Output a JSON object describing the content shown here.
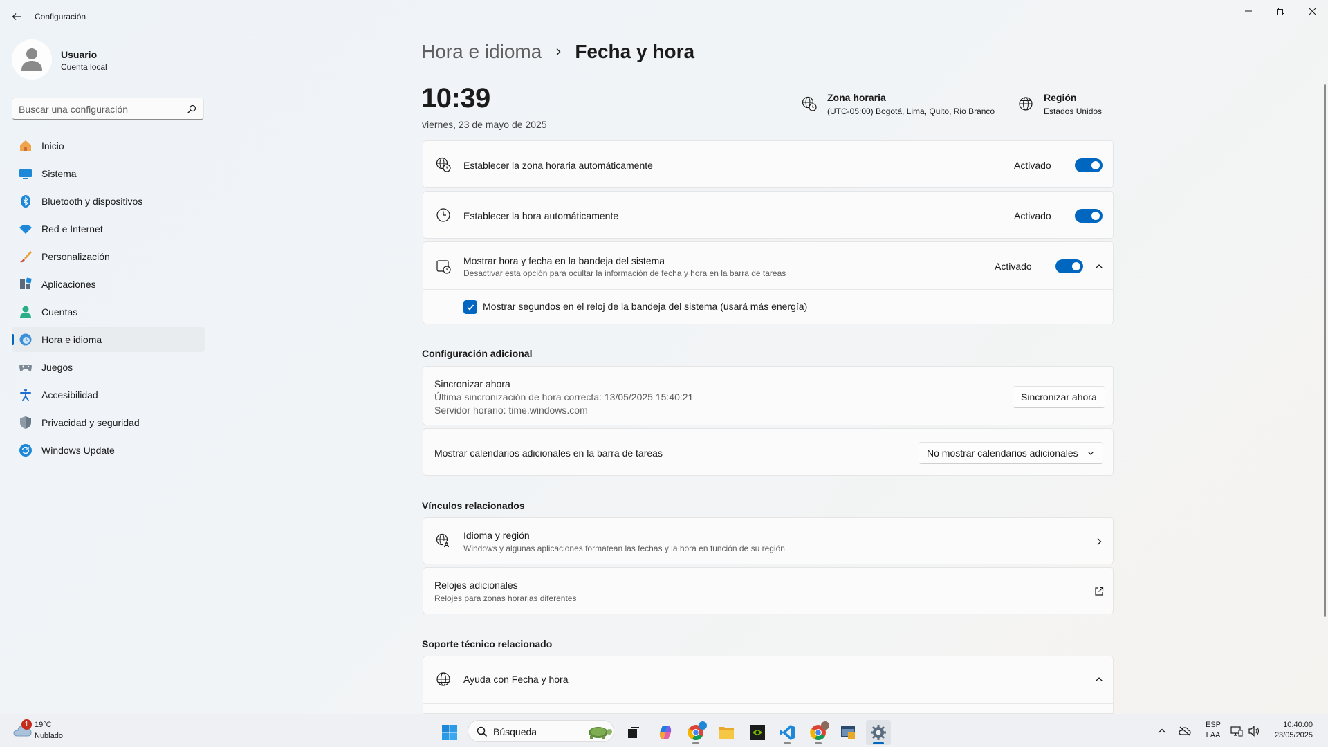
{
  "window": {
    "title": "Configuración"
  },
  "profile": {
    "name": "Usuario",
    "account": "Cuenta local"
  },
  "search": {
    "placeholder": "Buscar una configuración"
  },
  "sidebar": {
    "items": [
      {
        "label": "Inicio",
        "icon": "home-icon"
      },
      {
        "label": "Sistema",
        "icon": "system-icon"
      },
      {
        "label": "Bluetooth y dispositivos",
        "icon": "bluetooth-icon"
      },
      {
        "label": "Red e Internet",
        "icon": "wifi-icon"
      },
      {
        "label": "Personalización",
        "icon": "brush-icon"
      },
      {
        "label": "Aplicaciones",
        "icon": "apps-icon"
      },
      {
        "label": "Cuentas",
        "icon": "accounts-icon"
      },
      {
        "label": "Hora e idioma",
        "icon": "time-language-icon",
        "active": true
      },
      {
        "label": "Juegos",
        "icon": "gamepad-icon"
      },
      {
        "label": "Accesibilidad",
        "icon": "accessibility-icon"
      },
      {
        "label": "Privacidad y seguridad",
        "icon": "shield-icon"
      },
      {
        "label": "Windows Update",
        "icon": "update-icon"
      }
    ]
  },
  "breadcrumb": {
    "parent": "Hora e idioma",
    "current": "Fecha y hora"
  },
  "clock": {
    "time": "10:39",
    "date": "viernes, 23 de mayo de 2025"
  },
  "timezone": {
    "title": "Zona horaria",
    "value": "(UTC-05:00) Bogotá, Lima, Quito, Rio Branco"
  },
  "region": {
    "title": "Región",
    "value": "Estados Unidos"
  },
  "settings": {
    "auto_timezone": {
      "label": "Establecer la zona horaria automáticamente",
      "state": "Activado"
    },
    "auto_time": {
      "label": "Establecer la hora automáticamente",
      "state": "Activado"
    },
    "show_tray": {
      "label": "Mostrar hora y fecha en la bandeja del sistema",
      "description": "Desactivar esta opción para ocultar la información de fecha y hora en la barra de tareas",
      "state": "Activado"
    },
    "show_seconds": {
      "label": "Mostrar segundos en el reloj de la bandeja del sistema (usará más energía)",
      "checked": true
    }
  },
  "additional": {
    "heading": "Configuración adicional",
    "sync": {
      "title": "Sincronizar ahora",
      "last_sync": "Última sincronización de hora correcta: 13/05/2025 15:40:21",
      "server": "Servidor horario: time.windows.com",
      "button": "Sincronizar ahora"
    },
    "calendars": {
      "label": "Mostrar calendarios adicionales en la barra de tareas",
      "selected": "No mostrar calendarios adicionales"
    }
  },
  "related": {
    "heading": "Vínculos relacionados",
    "language_region": {
      "title": "Idioma y región",
      "description": "Windows y algunas aplicaciones formatean las fechas y la hora en función de su región"
    },
    "extra_clocks": {
      "title": "Relojes adicionales",
      "description": "Relojes para zonas horarias diferentes"
    }
  },
  "support": {
    "heading": "Soporte técnico relacionado",
    "help": "Ayuda con Fecha y hora"
  },
  "taskbar": {
    "weather": {
      "temp": "19°C",
      "condition": "Nublado",
      "badge": "1"
    },
    "search_placeholder": "Búsqueda",
    "lang": {
      "line1": "ESP",
      "line2": "LAA"
    },
    "clock": {
      "time": "10:40:00",
      "date": "23/05/2025"
    }
  },
  "colors": {
    "accent": "#0067c0"
  }
}
